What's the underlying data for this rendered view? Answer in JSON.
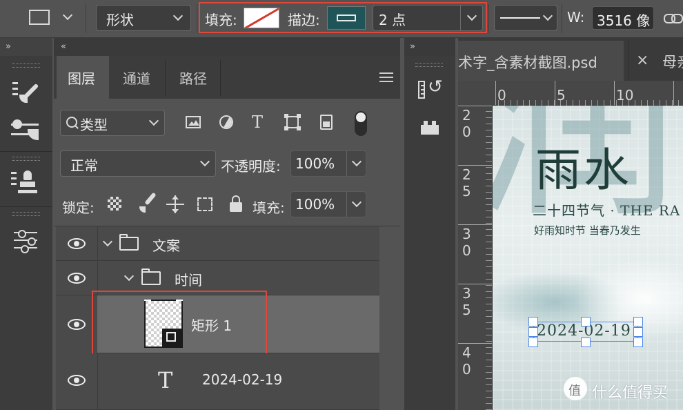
{
  "options_bar": {
    "shape_mode": "形状",
    "fill_label": "填充:",
    "stroke_label": "描边:",
    "stroke_width": "2 点",
    "width_label": "W:",
    "width_value": "3516 像"
  },
  "doc_tabs": [
    {
      "title": "术字_含素材截图.psd",
      "close": "×"
    },
    {
      "title": "母亲"
    }
  ],
  "layers_panel": {
    "tabs": [
      "图层",
      "通道",
      "路径"
    ],
    "filter_kind": "类型",
    "blend_mode": "正常",
    "opacity_label": "不透明度:",
    "opacity_value": "100%",
    "lock_label": "锁定:",
    "fill_label": "填充:",
    "fill_value": "100%",
    "layers": [
      {
        "name": "文案",
        "type": "group",
        "expanded": true
      },
      {
        "name": "时间",
        "type": "group",
        "expanded": true
      },
      {
        "name": "矩形 1",
        "type": "shape",
        "selected": true
      },
      {
        "name": "2024-02-19",
        "type": "text"
      }
    ]
  },
  "ruler": {
    "top": [
      "0",
      "5",
      "10"
    ],
    "left": [
      [
        "2",
        "0"
      ],
      [
        "2",
        "5"
      ],
      [
        "3",
        "0"
      ],
      [
        "3",
        "5"
      ],
      [
        "4",
        "0"
      ]
    ]
  },
  "canvas": {
    "big_title": "雨水",
    "subtitle": "二十四节气 · THE RA",
    "poem": "好雨知时节 当春乃发生",
    "date_text": "2024-02-19",
    "bg_glyph": "润"
  },
  "watermark": {
    "icon_glyph": "值",
    "text": "什么值得买"
  },
  "colors": {
    "accent_red": "#e2463a",
    "selection_blue": "#4a86e8",
    "stroke_swatch": "#1f5459",
    "title_green": "#1f3e3a"
  }
}
